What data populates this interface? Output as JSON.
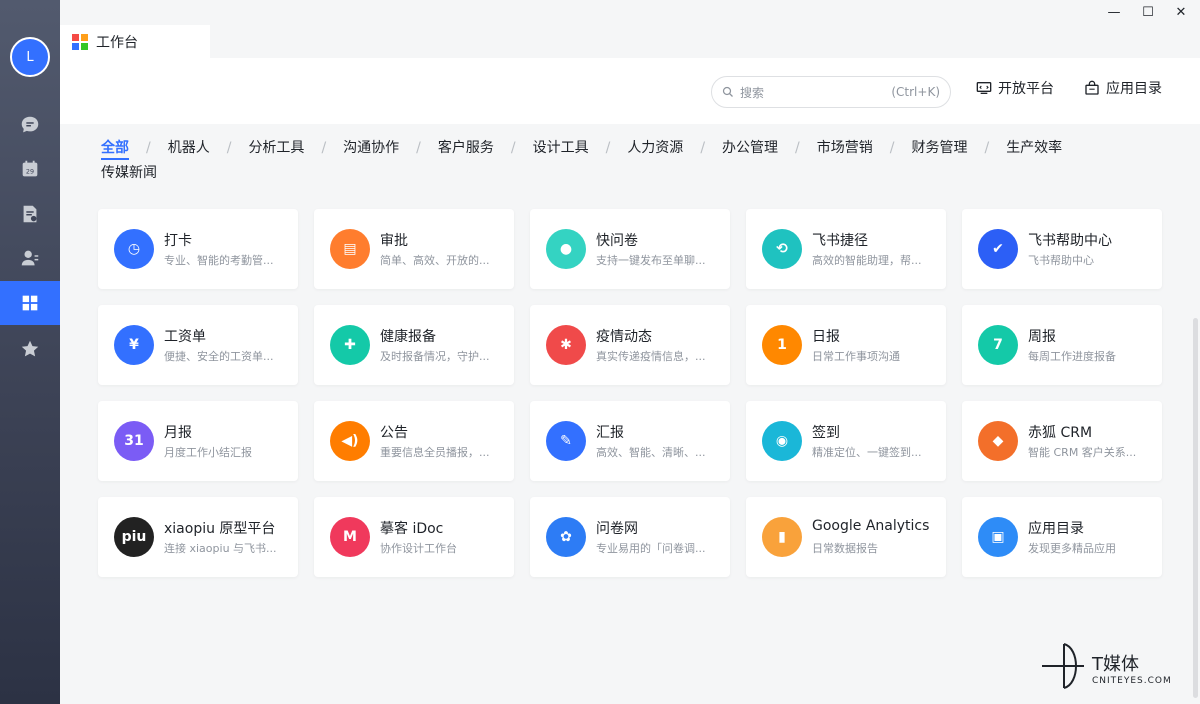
{
  "user": {
    "initial": "L"
  },
  "window": {
    "tab_title": "工作台",
    "minimize": "—",
    "maximize": "☐",
    "close": "✕"
  },
  "toolbar": {
    "search_placeholder": "搜索",
    "search_shortcut": "(Ctrl+K)",
    "open_platform_label": "开放平台",
    "app_directory_label": "应用目录"
  },
  "categories": [
    "全部",
    "机器人",
    "分析工具",
    "沟通协作",
    "客户服务",
    "设计工具",
    "人力资源",
    "办公管理",
    "市场营销",
    "财务管理",
    "生产效率",
    "传媒新闻"
  ],
  "apps": [
    {
      "name": "打卡",
      "desc": "专业、智能的考勤管...",
      "color": "#3370ff",
      "glyph": "◷"
    },
    {
      "name": "审批",
      "desc": "简单、高效、开放的...",
      "color": "#ff7d2e",
      "glyph": "▤"
    },
    {
      "name": "快问卷",
      "desc": "支持一键发布至单聊...",
      "color": "#34d3c2",
      "glyph": "●"
    },
    {
      "name": "飞书捷径",
      "desc": "高效的智能助理，帮...",
      "color": "#1fc2c0",
      "glyph": "⟲"
    },
    {
      "name": "飞书帮助中心",
      "desc": "飞书帮助中心",
      "color": "#2c5ff6",
      "glyph": "✔"
    },
    {
      "name": "工资单",
      "desc": "便捷、安全的工资单...",
      "color": "#3370ff",
      "glyph": "¥"
    },
    {
      "name": "健康报备",
      "desc": "及时报备情况，守护...",
      "color": "#14c9a8",
      "glyph": "✚"
    },
    {
      "name": "疫情动态",
      "desc": "真实传递疫情信息，...",
      "color": "#f04a4a",
      "glyph": "✱"
    },
    {
      "name": "日报",
      "desc": "日常工作事项沟通",
      "color": "#ff8800",
      "glyph": "1"
    },
    {
      "name": "周报",
      "desc": "每周工作进度报备",
      "color": "#14c9a8",
      "glyph": "7"
    },
    {
      "name": "月报",
      "desc": "月度工作小结汇报",
      "color": "#7b5cf5",
      "glyph": "31"
    },
    {
      "name": "公告",
      "desc": "重要信息全员播报，...",
      "color": "#ff7d00",
      "glyph": "◀)"
    },
    {
      "name": "汇报",
      "desc": "高效、智能、清晰、...",
      "color": "#3370ff",
      "glyph": "✎"
    },
    {
      "name": "签到",
      "desc": "精准定位、一键签到...",
      "color": "#1ab7d8",
      "glyph": "◉"
    },
    {
      "name": "赤狐 CRM",
      "desc": "智能 CRM 客户关系...",
      "color": "#f36f2a",
      "glyph": "◆"
    },
    {
      "name": "xiaopiu 原型平台",
      "desc": "连接 xiaopiu 与飞书...",
      "color": "#222222",
      "glyph": "piu"
    },
    {
      "name": "摹客 iDoc",
      "desc": "协作设计工作台",
      "color": "#f0395c",
      "glyph": "M"
    },
    {
      "name": "问卷网",
      "desc": "专业易用的「问卷调...",
      "color": "#2d7cf5",
      "glyph": "✿"
    },
    {
      "name": "Google Analytics",
      "desc": "日常数据报告",
      "color": "#f9a23b",
      "glyph": "▮"
    },
    {
      "name": "应用目录",
      "desc": "发现更多精品应用",
      "color": "#2e8cf7",
      "glyph": "▣"
    }
  ],
  "watermark": {
    "brand": "T媒体",
    "site": "CNITEYES.COM"
  }
}
